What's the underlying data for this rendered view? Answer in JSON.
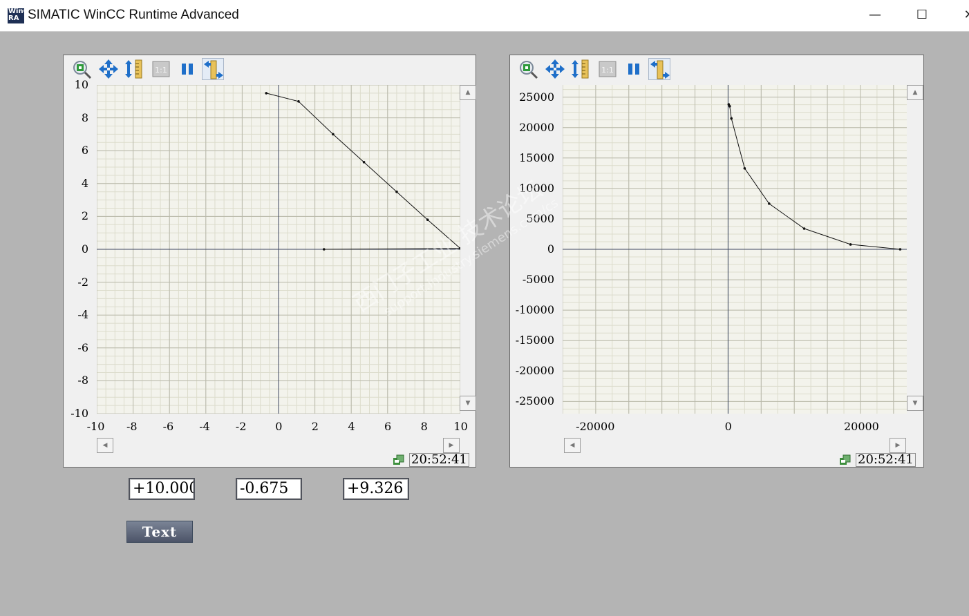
{
  "window": {
    "title": "SIMATIC WinCC Runtime Advanced",
    "icon_text": "WinCC RA",
    "icon": "wincc-app-icon",
    "minimize": "—",
    "maximize": "☐",
    "close": "✕"
  },
  "toolbar": {
    "icons": [
      "zoom-icon",
      "move-icon",
      "ruler-icon",
      "one-to-one-icon",
      "pause-icon",
      "ruler-move-icon"
    ],
    "one_to_one_label": "1:1"
  },
  "trend_left": {
    "status_time": "20:52:41",
    "status_icon": "status-icon"
  },
  "trend_right": {
    "status_time": "20:52:41",
    "status_icon": "status-icon"
  },
  "chart_data": [
    {
      "type": "scatter",
      "title": "",
      "xlabel": "",
      "ylabel": "",
      "xlim": [
        -10,
        10
      ],
      "ylim": [
        -10,
        10
      ],
      "x_tick_labels": [
        "-10",
        "-8",
        "-6",
        "-4",
        "-2",
        "0",
        "2",
        "4",
        "6",
        "8",
        "10"
      ],
      "y_tick_labels": [
        "10",
        "8",
        "6",
        "4",
        "2",
        "0",
        "-2",
        "-4",
        "-6",
        "-8",
        "-10"
      ],
      "grid": true,
      "series": [
        {
          "points": [
            [
              -0.675,
              9.5
            ],
            [
              1.1,
              9.0
            ],
            [
              3.0,
              7.0
            ],
            [
              4.7,
              5.3
            ],
            [
              6.5,
              3.5
            ],
            [
              8.2,
              1.8
            ],
            [
              10.0,
              0.05
            ]
          ]
        },
        {
          "points": [
            [
              2.5,
              0.0
            ],
            [
              10.0,
              0.05
            ]
          ]
        }
      ]
    },
    {
      "type": "scatter",
      "title": "",
      "xlabel": "",
      "ylabel": "",
      "xlim": [
        -25000,
        27000
      ],
      "ylim": [
        -27000,
        27000
      ],
      "x_tick_labels": [
        "-20000",
        "0",
        "20000"
      ],
      "y_tick_labels": [
        "25000",
        "20000",
        "15000",
        "10000",
        "5000",
        "0",
        "-5000",
        "-10000",
        "-15000",
        "-20000",
        "-25000"
      ],
      "grid": true,
      "series": [
        {
          "points": [
            [
              100,
              23800
            ],
            [
              250,
              23500
            ],
            [
              500,
              21500
            ],
            [
              2500,
              13300
            ],
            [
              6200,
              7500
            ],
            [
              11500,
              3400
            ],
            [
              18500,
              800
            ],
            [
              26000,
              0
            ]
          ]
        }
      ]
    }
  ],
  "fields": {
    "field1": "+10.000",
    "field2": "-0.675",
    "field3": "+9.326"
  },
  "text_button": "Text",
  "watermark": {
    "line1": "西门子工业 技术论坛",
    "line2": "support.industry.siemens.com/cs"
  }
}
